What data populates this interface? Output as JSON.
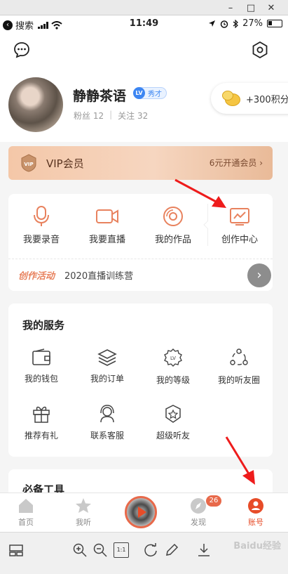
{
  "window": {
    "minimize_icon": "minimize-icon",
    "maximize_icon": "maximize-icon",
    "close_icon": "close-icon"
  },
  "statusbar": {
    "back_app": "搜索",
    "time": "11:49",
    "battery": "27%"
  },
  "profile": {
    "name": "静静茶语",
    "level_badge": "LV",
    "level_title": "秀才",
    "fans": "粉丝 12",
    "following": "关注 32",
    "points": "+300积分"
  },
  "vip": {
    "title": "VIP会员",
    "icon_text": "VIP",
    "cta": "6元开通会员"
  },
  "create": {
    "items": [
      {
        "label": "我要录音",
        "icon": "microphone-icon"
      },
      {
        "label": "我要直播",
        "icon": "video-camera-icon"
      },
      {
        "label": "我的作品",
        "icon": "disc-icon"
      },
      {
        "label": "创作中心",
        "icon": "chart-icon"
      }
    ],
    "activity_tag": "创作活动",
    "activity_text": "2020直播训练营"
  },
  "services": {
    "title": "我的服务",
    "items": [
      {
        "label": "我的钱包",
        "icon": "wallet-icon"
      },
      {
        "label": "我的订单",
        "icon": "layers-icon"
      },
      {
        "label": "我的等级",
        "icon": "level-icon"
      },
      {
        "label": "我的听友圈",
        "icon": "circle-friends-icon"
      },
      {
        "label": "推荐有礼",
        "icon": "gift-icon"
      },
      {
        "label": "联系客服",
        "icon": "headset-icon"
      },
      {
        "label": "超级听友",
        "icon": "star-badge-icon"
      }
    ],
    "level_icon_text": "LV"
  },
  "tools": {
    "title": "必备工具"
  },
  "tabbar": {
    "items": [
      {
        "label": "首页",
        "icon": "home-icon"
      },
      {
        "label": "我听",
        "icon": "star-icon"
      },
      {
        "label": "发现",
        "icon": "compass-icon"
      },
      {
        "label": "账号",
        "icon": "account-icon"
      }
    ],
    "discover_badge": "26",
    "active": "账号",
    "active_color": "#e74c28"
  },
  "viewer": {
    "zoom_reset": "1:1",
    "watermark": "Baidu经验"
  },
  "colors": {
    "accent": "#e8694a",
    "vip_bg": "#f4c7a8",
    "annotation": "#ee1c1c"
  }
}
